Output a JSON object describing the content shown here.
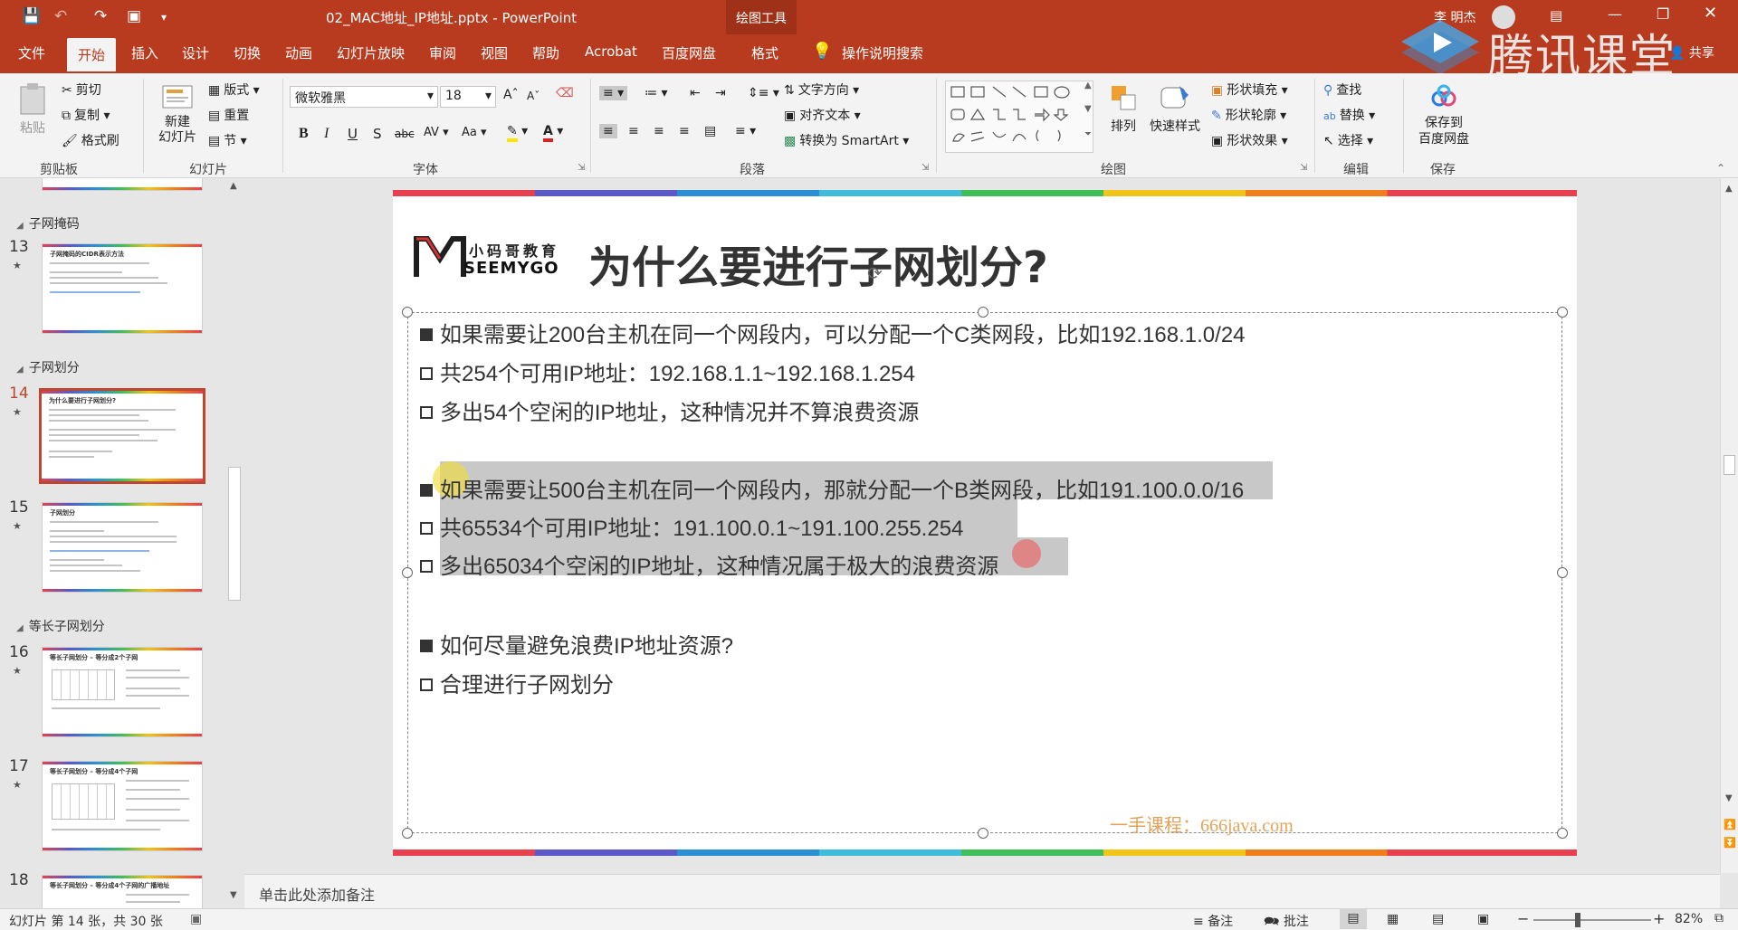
{
  "window": {
    "title": "02_MAC地址_IP地址.pptx - PowerPoint",
    "context_tab": "绘图工具",
    "user": "李 明杰",
    "share": "共享",
    "watermark_logo": "腾讯课堂"
  },
  "menu_tabs": [
    "文件",
    "开始",
    "插入",
    "设计",
    "切换",
    "动画",
    "幻灯片放映",
    "审阅",
    "视图",
    "帮助",
    "Acrobat",
    "百度网盘",
    "格式"
  ],
  "tell_me": "操作说明搜索",
  "ribbon": {
    "clipboard": {
      "label": "剪贴板",
      "paste": "粘贴",
      "cut": "剪切",
      "copy": "复制",
      "format_painter": "格式刷"
    },
    "slides": {
      "label": "幻灯片",
      "new_slide": "新建\n幻灯片",
      "layout": "版式",
      "reset": "重置",
      "section": "节"
    },
    "font": {
      "label": "字体",
      "font_name": "微软雅黑",
      "font_size": "18",
      "bold": "B",
      "italic": "I",
      "underline": "U",
      "shadow": "S",
      "strike": "abc",
      "spacing": "AV",
      "case": "Aa"
    },
    "paragraph": {
      "label": "段落",
      "text_direction": "文字方向",
      "align_text": "对齐文本",
      "smartart": "转换为 SmartArt"
    },
    "drawing": {
      "label": "绘图",
      "arrange": "排列",
      "quick_styles": "快速样式",
      "shape_fill": "形状填充",
      "shape_outline": "形状轮廓",
      "shape_effects": "形状效果"
    },
    "editing": {
      "label": "编辑",
      "find": "查找",
      "replace": "替换",
      "select": "选择"
    },
    "save": {
      "label": "保存",
      "save_to_baidu": "保存到\n百度网盘"
    }
  },
  "sections": [
    {
      "name": "子网掩码"
    },
    {
      "name": "子网划分"
    },
    {
      "name": "等长子网划分"
    }
  ],
  "thumbnails": [
    {
      "num": "13",
      "title": "子网掩码的CIDR表示方法"
    },
    {
      "num": "14",
      "title": "为什么要进行子网划分?"
    },
    {
      "num": "15",
      "title": "子网划分"
    },
    {
      "num": "16",
      "title": "等长子网划分 – 等分成2个子网"
    },
    {
      "num": "17",
      "title": "等长子网划分 – 等分成4个子网"
    },
    {
      "num": "18",
      "title": "等长子网划分 – 等分成4个子网的广播地址"
    }
  ],
  "slide": {
    "logo_cn": "小码哥教育",
    "logo_en": "SEEMYGO",
    "title": "为什么要进行子网划分?",
    "lines": [
      {
        "bullet": "filled",
        "text": "如果需要让200台主机在同一个网段内，可以分配一个C类网段，比如192.168.1.0/24",
        "highlight": false
      },
      {
        "bullet": "open",
        "text": "共254个可用IP地址：192.168.1.1~192.168.1.254",
        "highlight": false
      },
      {
        "bullet": "open",
        "text": "多出54个空闲的IP地址，这种情况并不算浪费资源",
        "highlight": false
      },
      {
        "bullet": "filled",
        "text": "如果需要让500台主机在同一个网段内，那就分配一个B类网段，比如191.100.0.0/16",
        "highlight": true
      },
      {
        "bullet": "open",
        "text": "共65534个可用IP地址：191.100.0.1~191.100.255.254",
        "highlight": true
      },
      {
        "bullet": "open",
        "text": "多出65034个空闲的IP地址，这种情况属于极大的浪费资源",
        "highlight": true
      },
      {
        "bullet": "filled",
        "text": "如何尽量避免浪费IP地址资源?",
        "highlight": false
      },
      {
        "bullet": "open",
        "text": "合理进行子网划分",
        "highlight": false
      }
    ],
    "watermark": "一手课程：666java.com"
  },
  "notes_placeholder": "单击此处添加备注",
  "status": {
    "slide_info": "幻灯片 第 14 张，共 30 张",
    "notes": "备注",
    "comments": "批注",
    "zoom": "82%"
  },
  "colors": {
    "accent": "#b83b1f",
    "highlight": "#c8c8c8"
  }
}
